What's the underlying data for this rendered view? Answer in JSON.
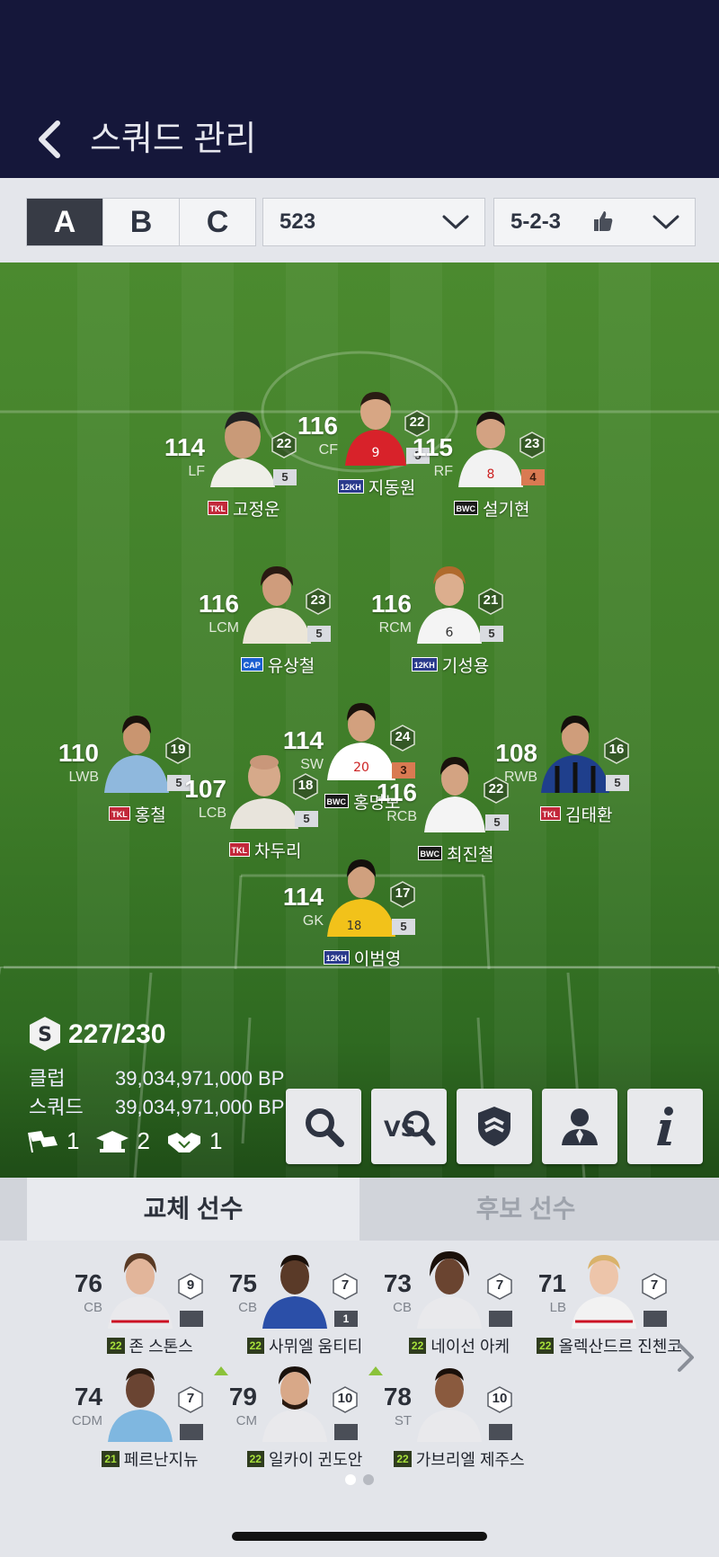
{
  "header": {
    "title": "스쿼드 관리"
  },
  "squad_tabs": [
    {
      "label": "A",
      "active": true
    },
    {
      "label": "B",
      "active": false
    },
    {
      "label": "C",
      "active": false
    }
  ],
  "formation_dropdown": {
    "value": "523"
  },
  "tactic_dropdown": {
    "value": "5-2-3"
  },
  "starters": [
    {
      "ovr": "114",
      "pos": "LF",
      "hex": "22",
      "lvl": "5",
      "badge": "TKL",
      "name": "고정운",
      "jersey": "#efefe8",
      "kit": "#d8d2c5"
    },
    {
      "ovr": "116",
      "pos": "CF",
      "hex": "22",
      "lvl": "5",
      "badge": "12KH",
      "name": "지동원",
      "jersey": "#d8222a",
      "kit": "#c41a22"
    },
    {
      "ovr": "115",
      "pos": "RF",
      "hex": "23",
      "lvl": "4",
      "badge": "BWC",
      "name": "설기현",
      "jersey": "#f2f2f2",
      "kit": "#e8e8e8",
      "lvl_orange": true
    },
    {
      "ovr": "116",
      "pos": "LCM",
      "hex": "23",
      "lvl": "5",
      "badge": "CAP",
      "name": "유상철",
      "jersey": "#ece6d8",
      "kit": "#d9d2c2"
    },
    {
      "ovr": "116",
      "pos": "RCM",
      "hex": "21",
      "lvl": "5",
      "badge": "12KH",
      "name": "기성용",
      "jersey": "#f4f4f4",
      "kit": "#e8e8e8"
    },
    {
      "ovr": "110",
      "pos": "LWB",
      "hex": "19",
      "lvl": "5",
      "badge": "TKL",
      "name": "홍철",
      "jersey": "#8fb8dd",
      "kit": "#a8c8e6"
    },
    {
      "ovr": "114",
      "pos": "SW",
      "hex": "24",
      "lvl": "3",
      "badge": "BWC",
      "name": "홍명보",
      "jersey": "#ffffff",
      "kit": "#f0f0f0",
      "lvl_orange": true
    },
    {
      "ovr": "108",
      "pos": "RWB",
      "hex": "16",
      "lvl": "5",
      "badge": "TKL",
      "name": "김태환",
      "jersey": "#1f3f8c",
      "kit": "#17306e"
    },
    {
      "ovr": "107",
      "pos": "LCB",
      "hex": "18",
      "lvl": "5",
      "badge": "TKL",
      "name": "차두리",
      "jersey": "#e8e4dc",
      "kit": "#d8d2c6"
    },
    {
      "ovr": "116",
      "pos": "RCB",
      "hex": "22",
      "lvl": "5",
      "badge": "BWC",
      "name": "최진철",
      "jersey": "#f4f4f4",
      "kit": "#eaeaea"
    },
    {
      "ovr": "114",
      "pos": "GK",
      "hex": "17",
      "lvl": "5",
      "badge": "12KH",
      "name": "이범영",
      "jersey": "#f2c21a",
      "kit": "#e9b90f"
    }
  ],
  "squad_stats": {
    "salary": "227/230",
    "club_label": "클럽",
    "club_value": "39,034,971,000 BP",
    "squad_label": "스쿼드",
    "squad_value": "39,034,971,000 BP",
    "flags_count": "1",
    "cap_count": "2",
    "handshake_count": "1"
  },
  "bench_tabs": {
    "active": "교체 선수",
    "inactive": "후보 선수"
  },
  "subs": [
    {
      "ovr": "76",
      "pos": "CB",
      "hex": "9",
      "lvl": "",
      "season": "22",
      "name": "존 스톤스",
      "jersey": "#e9e9ec"
    },
    {
      "ovr": "75",
      "pos": "CB",
      "hex": "7",
      "lvl": "1",
      "season": "22",
      "name": "사뮈엘 움티티",
      "jersey": "#2b4fa8"
    },
    {
      "ovr": "73",
      "pos": "CB",
      "hex": "7",
      "lvl": "",
      "season": "22",
      "name": "네이선 아케",
      "jersey": "#e9e9ec"
    },
    {
      "ovr": "71",
      "pos": "LB",
      "hex": "7",
      "lvl": "",
      "season": "22",
      "name": "올렉산드르 진첸코",
      "jersey": "#f2f2f2"
    },
    {
      "ovr": "74",
      "pos": "CDM",
      "hex": "7",
      "lvl": "",
      "season": "21",
      "name": "페르난지뉴",
      "jersey": "#7fb7e0"
    },
    {
      "ovr": "79",
      "pos": "CM",
      "hex": "10",
      "lvl": "",
      "season": "22",
      "name": "일카이 귄도안",
      "jersey": "#e9e9ec",
      "up": true
    },
    {
      "ovr": "78",
      "pos": "ST",
      "hex": "10",
      "lvl": "",
      "season": "22",
      "name": "가브리엘 제주스",
      "jersey": "#e9e9ec",
      "up": true
    }
  ],
  "icons": {
    "back": "chevron-left-icon",
    "search": "search-icon",
    "compare": "vs-search-icon",
    "team": "shield-icon",
    "manager": "person-icon",
    "info": "info-icon"
  },
  "colors": {
    "header_bg": "#15173a",
    "pitch": "#3f7d29",
    "active_tab": "#373b45",
    "season_badge": "#a7e03b"
  }
}
